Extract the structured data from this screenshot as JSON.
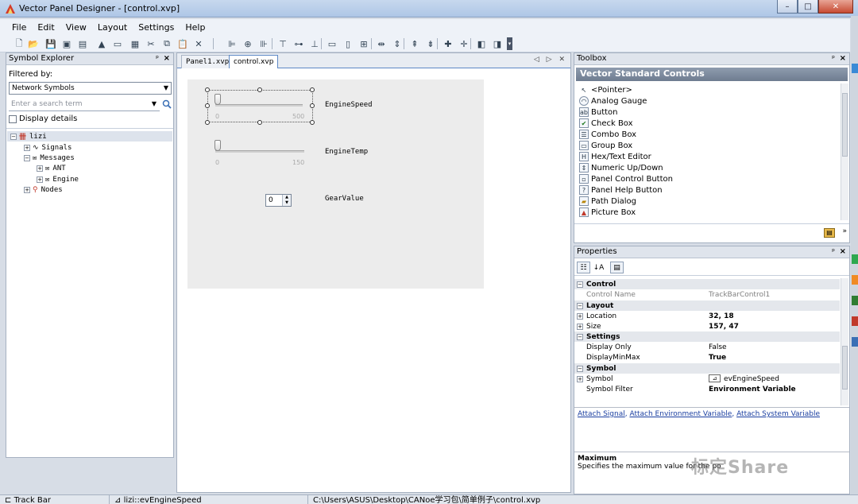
{
  "window": {
    "title": "Vector Panel Designer - [control.xvp]",
    "minimize": "–",
    "maximize": "□",
    "close": "✕"
  },
  "menu": [
    "File",
    "Edit",
    "View",
    "Layout",
    "Settings",
    "Help"
  ],
  "symbol_explorer": {
    "title": "Symbol Explorer",
    "pin": "ᵖ",
    "close": "×",
    "filtered_by_label": "Filtered by:",
    "filter_value": "Network Symbols",
    "search_placeholder": "Enter a search term",
    "display_details": "Display details",
    "tree": [
      {
        "label": "lizi",
        "expander": "⊟"
      },
      {
        "label": "Signals",
        "expander": "⊞"
      },
      {
        "label": "Messages",
        "expander": "⊟"
      },
      {
        "label": "ANT",
        "expander": "⊞"
      },
      {
        "label": "Engine",
        "expander": "⊞"
      },
      {
        "label": "Nodes",
        "expander": "⊞"
      }
    ]
  },
  "document": {
    "tabs": [
      "Panel1.xvp",
      "control.xvp"
    ],
    "nav": "◁ ▷ ✕",
    "controls": {
      "engine_speed": {
        "label": "EngineSpeed",
        "min": "0",
        "max": "500"
      },
      "engine_temp": {
        "label": "EngineTemp",
        "min": "0",
        "max": "150"
      },
      "gear_value": {
        "label": "GearValue",
        "value": "0"
      }
    }
  },
  "toolbox": {
    "title": "Toolbox",
    "group": "Vector Standard Controls",
    "items": [
      {
        "label": "<Pointer>",
        "icon": "pointer-icon"
      },
      {
        "label": "Analog Gauge",
        "icon": "gauge-icon"
      },
      {
        "label": "Button",
        "icon": "button-icon"
      },
      {
        "label": "Check Box",
        "icon": "checkbox-icon"
      },
      {
        "label": "Combo Box",
        "icon": "combobox-icon"
      },
      {
        "label": "Group Box",
        "icon": "groupbox-icon"
      },
      {
        "label": "Hex/Text Editor",
        "icon": "hex-editor-icon"
      },
      {
        "label": "Numeric Up/Down",
        "icon": "numeric-icon"
      },
      {
        "label": "Panel Control Button",
        "icon": "panel-control-icon"
      },
      {
        "label": "Panel Help Button",
        "icon": "help-button-icon"
      },
      {
        "label": "Path Dialog",
        "icon": "path-dialog-icon"
      },
      {
        "label": "Picture Box",
        "icon": "picture-box-icon"
      }
    ]
  },
  "properties": {
    "title": "Properties",
    "rows": [
      {
        "type": "cat",
        "name": "Control"
      },
      {
        "type": "prop",
        "name": "Control Name",
        "value": "TrackBarControl1",
        "style": "gray"
      },
      {
        "type": "cat",
        "name": "Layout"
      },
      {
        "type": "prop",
        "name": "Location",
        "value": "32, 18",
        "style": "bold",
        "expandable": true
      },
      {
        "type": "prop",
        "name": "Size",
        "value": "157, 47",
        "style": "bold",
        "expandable": true
      },
      {
        "type": "cat",
        "name": "Settings"
      },
      {
        "type": "prop",
        "name": "Display Only",
        "value": "False",
        "style": "normal"
      },
      {
        "type": "prop",
        "name": "DisplayMinMax",
        "value": "True",
        "style": "bold"
      },
      {
        "type": "cat",
        "name": "Symbol"
      },
      {
        "type": "prop",
        "name": "Symbol",
        "value": "evEngineSpeed",
        "style": "normal",
        "expandable": true
      },
      {
        "type": "prop",
        "name": "Symbol Filter",
        "value": "Environment Variable",
        "style": "bold"
      }
    ],
    "links": [
      "Attach Signal",
      "Attach Environment Variable",
      "Attach System Variable"
    ],
    "desc_title": "Maximum",
    "desc_text": "Specifies the maximum value for the po"
  },
  "statusbar": {
    "control": "Track Bar",
    "symbol": "lizi::evEngineSpeed",
    "path": "C:\\Users\\ASUS\\Desktop\\CANoe学习包\\简单例子\\control.xvp"
  },
  "watermark": "标定Share",
  "colors": {
    "accent": "#5d88c5",
    "group_header": "#7b889c",
    "link": "#1a3ea0"
  }
}
